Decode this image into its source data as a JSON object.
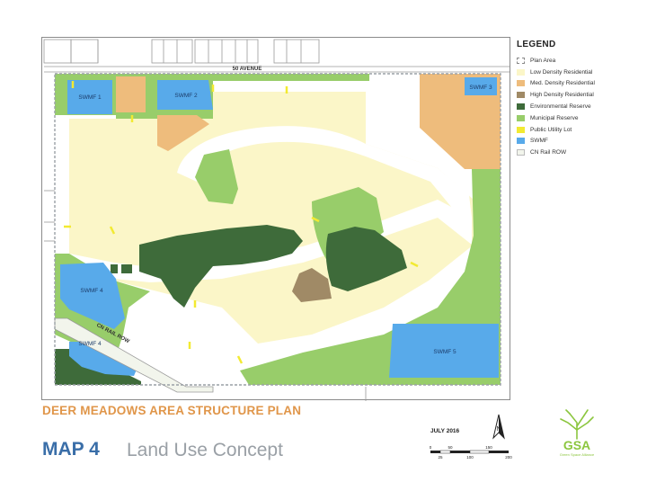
{
  "map": {
    "street_label": "50 AVENUE",
    "rail_label": "CN RAIL ROW",
    "swmf_labels": [
      "SWMF 1",
      "SWMF 2",
      "SWMF 3",
      "SWMF 4",
      "SWMF 4",
      "SWMF 5"
    ]
  },
  "legend": {
    "title": "LEGEND",
    "items": [
      {
        "label": "Plan Area",
        "color": "#ffffff"
      },
      {
        "label": "Low Density Residential",
        "color": "#fbf6c8"
      },
      {
        "label": "Med. Density Residential",
        "color": "#eebc7c"
      },
      {
        "label": "High Density Residential",
        "color": "#a08a66"
      },
      {
        "label": "Environmental Reserve",
        "color": "#3e6b3a"
      },
      {
        "label": "Municipal Reserve",
        "color": "#98cd6a"
      },
      {
        "label": "Public Utility Lot",
        "color": "#f2ea32"
      },
      {
        "label": "SWMF",
        "color": "#58aaea"
      },
      {
        "label": "CN Rail ROW",
        "color": "#f2f5ec"
      }
    ]
  },
  "title": {
    "plan_name": "DEER MEADOWS AREA STRUCTURE PLAN",
    "map_number": "MAP 4",
    "map_subtitle": "Land Use Concept",
    "date": "JULY 2016"
  },
  "north_arrow": {
    "label": "N"
  },
  "scale_bar": {
    "top_ticks": [
      "0",
      "50",
      "150"
    ],
    "bottom_ticks": [
      "25",
      "100",
      "200"
    ]
  },
  "logo": {
    "text": "GSA",
    "subtext": "Green Space Alliance"
  }
}
